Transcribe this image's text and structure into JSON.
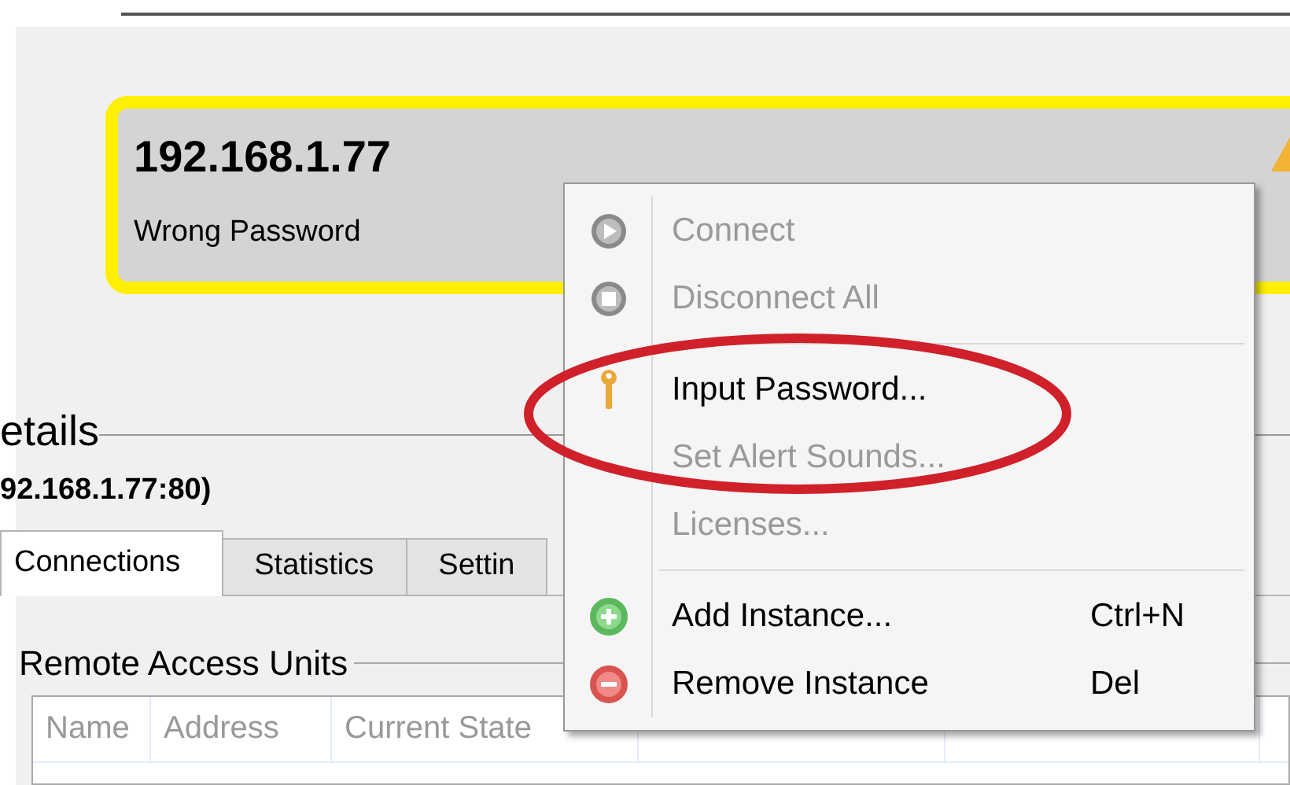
{
  "device_card": {
    "title": "192.168.1.77",
    "status": "Wrong Password",
    "warning": true
  },
  "details": {
    "title": "etails",
    "subtitle": "92.168.1.77:80)"
  },
  "tabs": [
    {
      "label": "Connections",
      "selected": true
    },
    {
      "label": "Statistics",
      "selected": false
    },
    {
      "label": "Settin",
      "selected": false
    }
  ],
  "group": {
    "title": "Remote Access Units"
  },
  "table": {
    "columns": [
      "Name",
      "Address",
      "Current State"
    ]
  },
  "context_menu": {
    "items": [
      {
        "kind": "play",
        "label": "Connect",
        "disabled": true
      },
      {
        "kind": "stop",
        "label": "Disconnect All",
        "disabled": true
      },
      {
        "kind": "separator"
      },
      {
        "kind": "key",
        "label": "Input Password...",
        "disabled": false,
        "highlighted": true
      },
      {
        "kind": "plain",
        "label": "Set Alert Sounds...",
        "disabled": true
      },
      {
        "kind": "plain",
        "label": "Licenses...",
        "disabled": true
      },
      {
        "kind": "separator"
      },
      {
        "kind": "add",
        "label": "Add Instance...",
        "shortcut": "Ctrl+N",
        "disabled": false
      },
      {
        "kind": "remove",
        "label": "Remove Instance",
        "shortcut": "Del",
        "disabled": false
      }
    ]
  }
}
